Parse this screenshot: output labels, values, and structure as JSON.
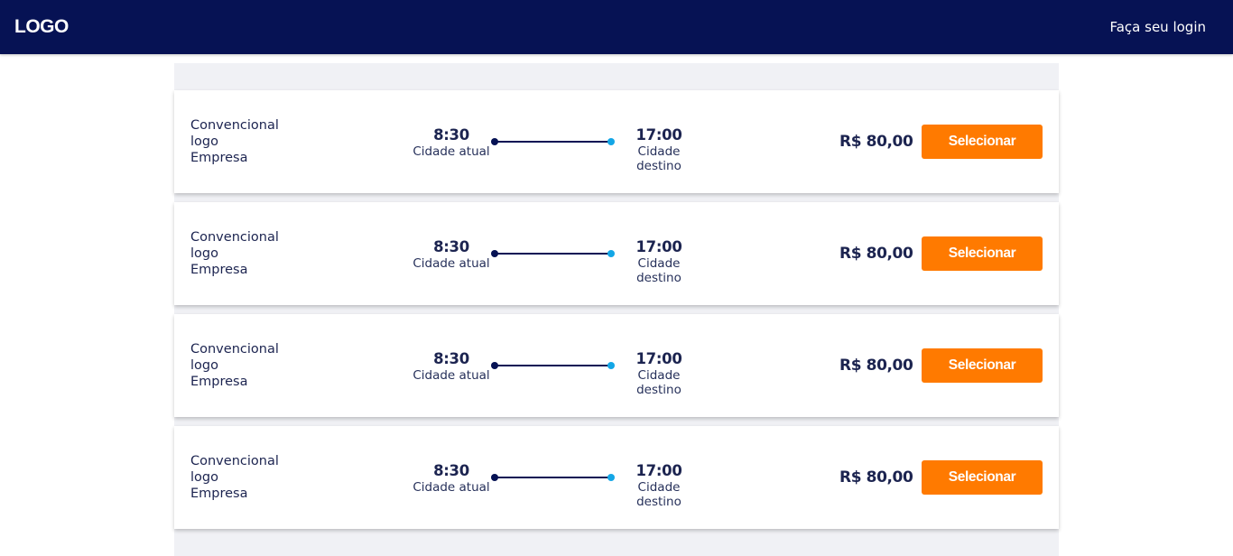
{
  "header": {
    "logo": "LOGO",
    "login_link": "Faça seu login"
  },
  "colors": {
    "header_bg": "#061254",
    "accent_button": "#ff7a00",
    "route_end_dot": "#13a6e6",
    "results_bg": "#f0f1f5"
  },
  "trips": [
    {
      "class": "Convencional",
      "company_logo": "logo",
      "company": "Empresa",
      "departure_time": "8:30",
      "departure_city": "Cidade atual",
      "arrival_time": "17:00",
      "arrival_city": "Cidade destino",
      "price": "R$ 80,00",
      "select_label": "Selecionar"
    },
    {
      "class": "Convencional",
      "company_logo": "logo",
      "company": "Empresa",
      "departure_time": "8:30",
      "departure_city": "Cidade atual",
      "arrival_time": "17:00",
      "arrival_city": "Cidade destino",
      "price": "R$ 80,00",
      "select_label": "Selecionar"
    },
    {
      "class": "Convencional",
      "company_logo": "logo",
      "company": "Empresa",
      "departure_time": "8:30",
      "departure_city": "Cidade atual",
      "arrival_time": "17:00",
      "arrival_city": "Cidade destino",
      "price": "R$ 80,00",
      "select_label": "Selecionar"
    },
    {
      "class": "Convencional",
      "company_logo": "logo",
      "company": "Empresa",
      "departure_time": "8:30",
      "departure_city": "Cidade atual",
      "arrival_time": "17:00",
      "arrival_city": "Cidade destino",
      "price": "R$ 80,00",
      "select_label": "Selecionar"
    }
  ]
}
